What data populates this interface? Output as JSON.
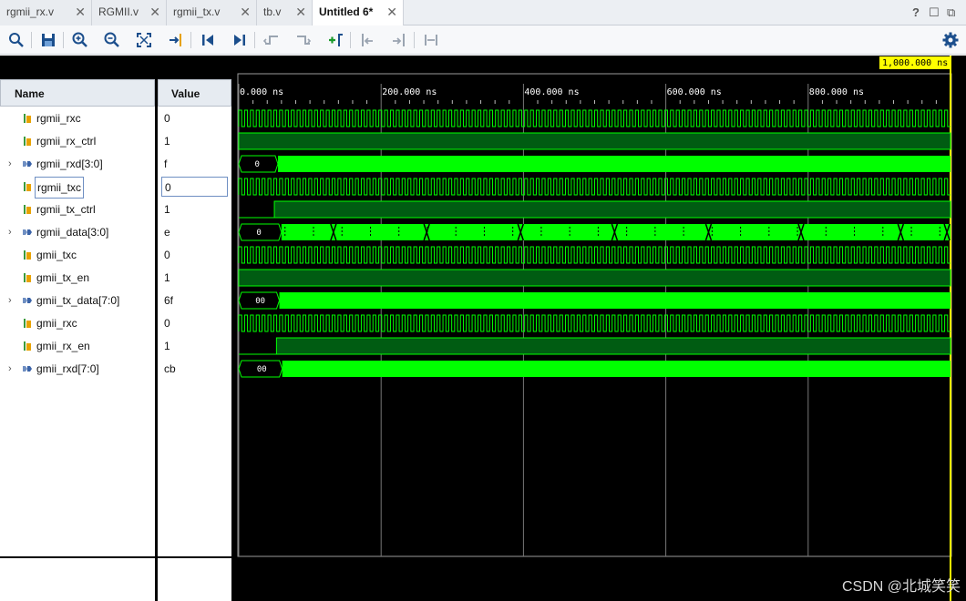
{
  "tabs": [
    {
      "label": "rgmii_rx.v",
      "active": false
    },
    {
      "label": "RGMII.v",
      "active": false
    },
    {
      "label": "rgmii_tx.v",
      "active": false
    },
    {
      "label": "tb.v",
      "active": false
    },
    {
      "label": "Untitled 6*",
      "active": true
    }
  ],
  "window_buttons": {
    "help": "?",
    "restore": "☐",
    "popout": "⧉"
  },
  "toolbar": [
    "search-icon",
    "save-icon",
    "zoom-in-icon",
    "zoom-out-icon",
    "zoom-fit-icon",
    "go-to-cursor-icon",
    "go-to-start-icon",
    "go-to-end-icon",
    "previous-transition-icon",
    "next-transition-icon",
    "add-marker-icon",
    "previous-marker-icon",
    "next-marker-icon",
    "swap-cursors-icon",
    "settings-icon"
  ],
  "columns": {
    "name": "Name",
    "value": "Value"
  },
  "cursor": {
    "label": "1,000.000 ns",
    "time_ns": 1000
  },
  "time_axis": {
    "ticks": [
      "0.000 ns",
      "200.000 ns",
      "400.000 ns",
      "600.000 ns",
      "800.000 ns"
    ],
    "range_ns": [
      0,
      1000
    ]
  },
  "signals": [
    {
      "name": "rgmii_rxc",
      "value": "0",
      "kind": "clock",
      "bus": false
    },
    {
      "name": "rgmii_rx_ctrl",
      "value": "1",
      "kind": "high",
      "bus": false
    },
    {
      "name": "rgmii_rxd[3:0]",
      "value": "f",
      "kind": "bus",
      "bus": true,
      "initial": "0"
    },
    {
      "name": "rgmii_txc",
      "value": "0",
      "kind": "clock",
      "bus": false
    },
    {
      "name": "rgmii_tx_ctrl",
      "value": "1",
      "kind": "rise",
      "bus": false
    },
    {
      "name": "rgmii_data[3:0]",
      "value": "e",
      "kind": "busy",
      "bus": true,
      "initial": "0"
    },
    {
      "name": "gmii_txc",
      "value": "0",
      "kind": "clock",
      "bus": false
    },
    {
      "name": "gmii_tx_en",
      "value": "1",
      "kind": "high",
      "bus": false
    },
    {
      "name": "gmii_tx_data[7:0]",
      "value": "6f",
      "kind": "bus",
      "bus": true,
      "initial": "00"
    },
    {
      "name": "gmii_rxc",
      "value": "0",
      "kind": "clock",
      "bus": false
    },
    {
      "name": "gmii_rx_en",
      "value": "1",
      "kind": "rise",
      "bus": false
    },
    {
      "name": "gmii_rxd[7:0]",
      "value": "cb",
      "kind": "bus",
      "bus": true,
      "initial": "00"
    }
  ],
  "watermark": "CSDN @北城笑笑"
}
